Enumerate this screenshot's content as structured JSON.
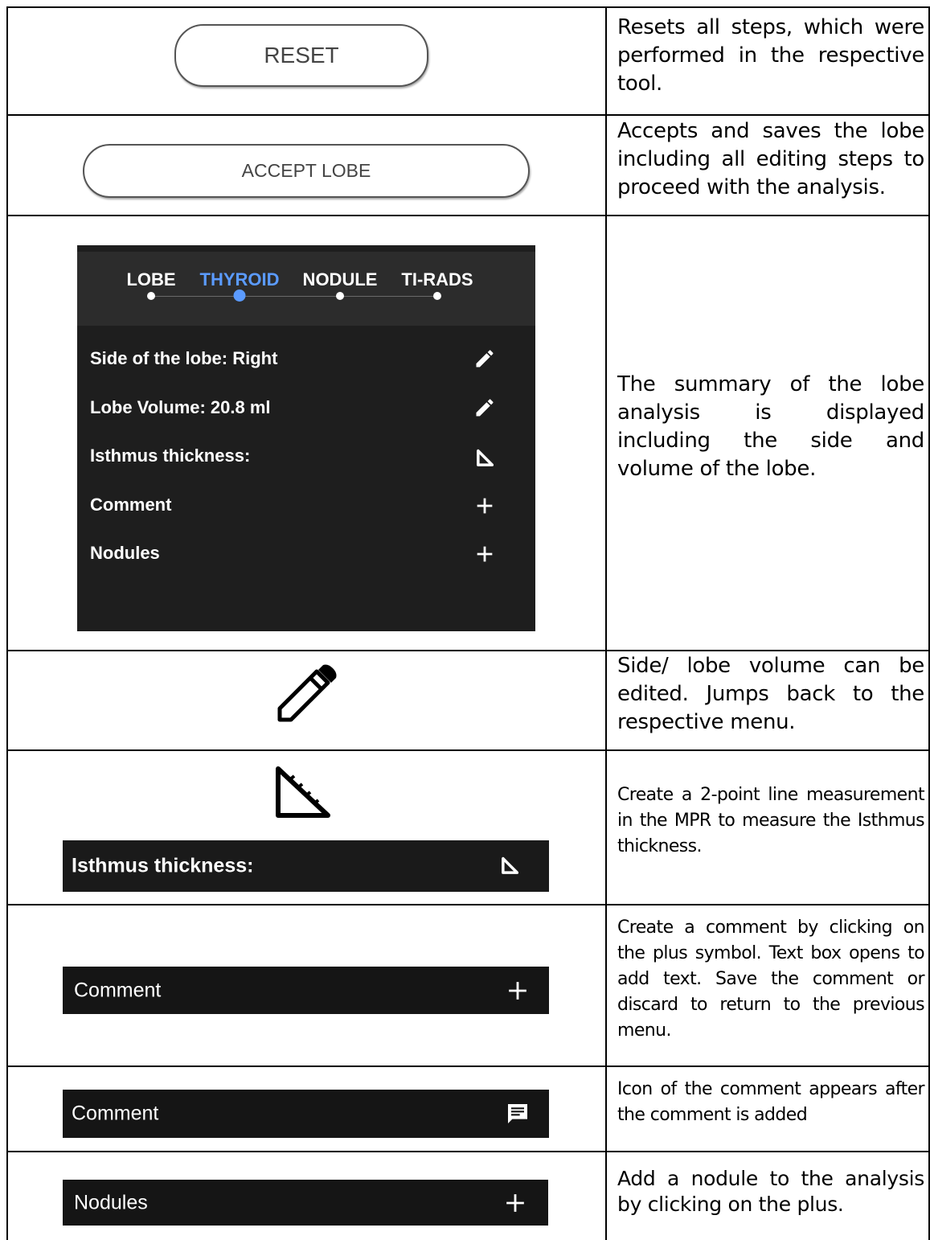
{
  "rows": [
    {
      "button_label": "RESET",
      "description": "Resets all steps, which were performed in the respective tool."
    },
    {
      "button_label": "ACCEPT LOBE",
      "description": "Accepts and saves the lobe including all editing steps to proceed with the analysis."
    },
    {
      "panel": {
        "steps": [
          "LOBE",
          "THYROID",
          "NODULE",
          "TI-RADS"
        ],
        "active_step": "THYROID",
        "items": [
          {
            "label": "Side of the lobe: Right",
            "icon": "pencil-icon"
          },
          {
            "label": "Lobe Volume: 20.8 ml",
            "icon": "pencil-icon"
          },
          {
            "label": "Isthmus thickness:",
            "icon": "ruler-triangle-icon"
          },
          {
            "label": "Comment",
            "icon": "plus-icon"
          },
          {
            "label": "Nodules",
            "icon": "plus-icon"
          }
        ]
      },
      "description": "The summary of the lobe analysis is displayed including the side and volume of the lobe."
    },
    {
      "icon": "pencil-icon",
      "description": "Side/ lobe volume can be edited. Jumps back to the respective menu."
    },
    {
      "icon": "ruler-triangle-icon",
      "bar_label": "Isthmus thickness:",
      "description": "Create a 2-point line measurement in the MPR to measure the Isthmus thickness."
    },
    {
      "bar_label": "Comment",
      "bar_icon": "plus-icon",
      "description": "Create a comment by clicking on the plus symbol. Text box opens to add text. Save the comment or discard to return to the previous menu."
    },
    {
      "bar_label": "Comment",
      "bar_icon": "comment-icon",
      "description": "Icon of the comment appears after the comment is added"
    },
    {
      "bar_label": "Nodules",
      "bar_icon": "plus-icon",
      "description": "Add a nodule to the analysis by clicking on the plus."
    }
  ],
  "colors": {
    "panel_bg": "#1e1e1e",
    "panel_header_bg": "#2c2c2c",
    "active_step": "#5b9bff",
    "bar_bg": "#151515"
  }
}
